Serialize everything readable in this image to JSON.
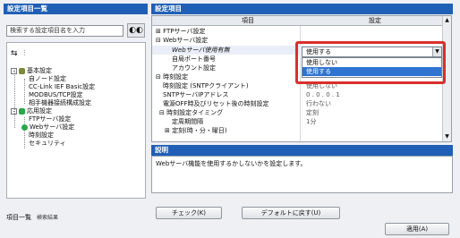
{
  "left_pane": {
    "title": "設定項目一覧",
    "search_placeholder": "検索する設定項目名を入力",
    "search_button_icon": "binoculars-icon",
    "tree": [
      {
        "label": "基本設定",
        "level": 0,
        "icon": "folder"
      },
      {
        "label": "自ノード設定",
        "level": 1
      },
      {
        "label": "CC-Link IEF Basic設定",
        "level": 1
      },
      {
        "label": "MODBUS/TCP設定",
        "level": 1
      },
      {
        "label": "相手機器接続構成設定",
        "level": 1
      },
      {
        "label": "応用設定",
        "level": 0,
        "icon": "folder"
      },
      {
        "label": "FTPサーバ設定",
        "level": 1
      },
      {
        "label": "Webサーバ設定",
        "level": 1
      },
      {
        "label": "時刻設定",
        "level": 1
      },
      {
        "label": "セキュリティ",
        "level": 1
      }
    ],
    "search_result_label": "項目一覧",
    "search_result_tab": "検索結果"
  },
  "right_pane": {
    "title": "設定項目",
    "columns": [
      "項目",
      "設定"
    ],
    "rows": [
      {
        "name": "FTPサーバ設定",
        "value": "",
        "indent": 0,
        "expander": "+"
      },
      {
        "name": "Webサーバ設定",
        "value": "",
        "indent": 0,
        "expander": "-"
      },
      {
        "name": "Webサーバ使用有無",
        "value": "",
        "indent": 2,
        "selected": true
      },
      {
        "name": "自局ポート番号",
        "value": "",
        "indent": 2
      },
      {
        "name": "アカウント設定",
        "value": "",
        "indent": 2
      },
      {
        "name": "時刻設定",
        "value": "",
        "indent": 0,
        "expander": "-"
      },
      {
        "name": "時刻設定 (SNTPクライアント)",
        "value": "使用しない",
        "indent": 1
      },
      {
        "name": "SNTPサーバIPアドレス",
        "value": "0 . 0 . 0 . 1",
        "indent": 1
      },
      {
        "name": "電源OFF時及びリセット後の時刻設定",
        "value": "行わない",
        "indent": 1
      },
      {
        "name": "時刻設定タイミング",
        "value": "定刻",
        "indent": 1,
        "expander": "-"
      },
      {
        "name": "定周期間隔",
        "value": "1分",
        "indent": 2
      },
      {
        "name": "定刻(時・分・曜日)",
        "value": "",
        "indent": 2,
        "expander": "+"
      }
    ],
    "dropdown": {
      "value": "使用する",
      "options": [
        "使用しない",
        "使用する"
      ],
      "highlighted": "使用する"
    },
    "description_title": "説明",
    "description_text": "Webサーバ機能を使用するかしないかを設定します。",
    "buttons": {
      "check": "チェック(K)",
      "default": "デフォルトに戻す(U)",
      "apply": "適用(A)"
    }
  },
  "colors": {
    "title_bar": "#1f5fb6",
    "highlight_frame": "#d9302c",
    "dropdown_selected": "#2f74d0"
  }
}
